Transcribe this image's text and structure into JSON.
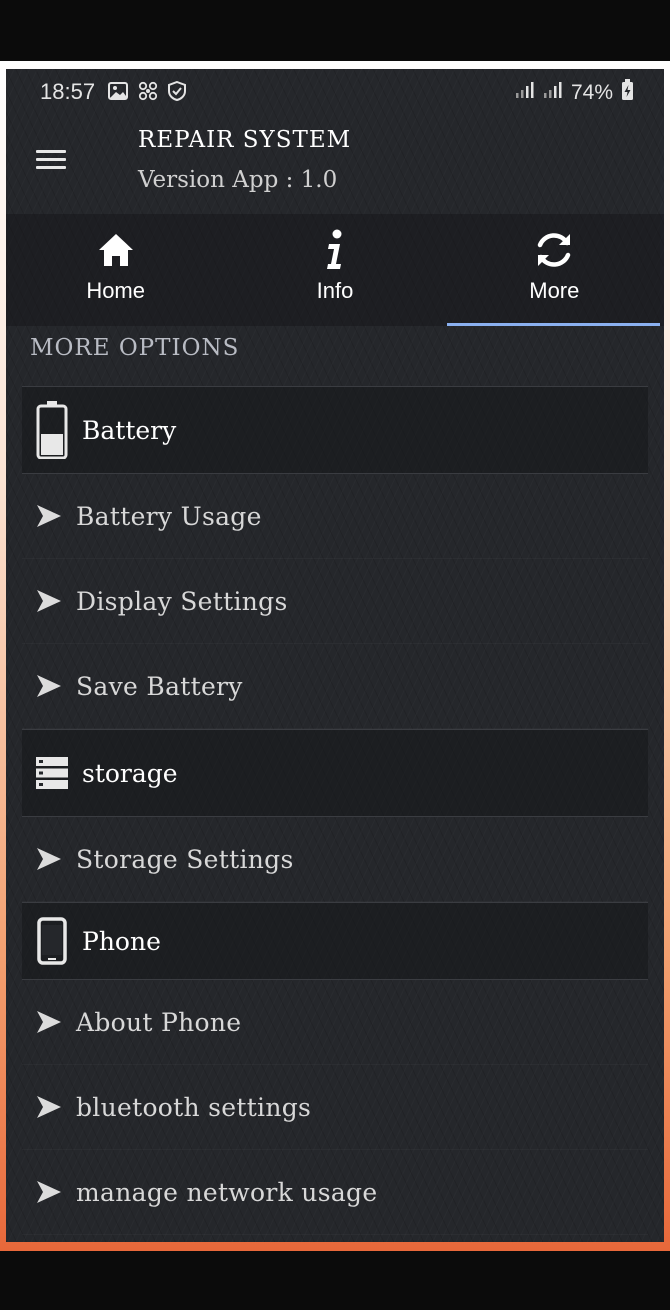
{
  "status_bar": {
    "time": "18:57",
    "battery_percent": "74%",
    "icons": [
      "image-icon",
      "fan-icon",
      "shield-icon",
      "signal-icon",
      "signal-icon",
      "battery-charging-icon"
    ]
  },
  "header": {
    "title": "REPAIR SYSTEM",
    "version": "Version App : 1.0"
  },
  "tabs": [
    {
      "label": "Home",
      "icon": "home-icon",
      "active": false
    },
    {
      "label": "Info",
      "icon": "info-icon",
      "active": false
    },
    {
      "label": "More",
      "icon": "refresh-icon",
      "active": true
    }
  ],
  "section_title": "MORE OPTIONS",
  "groups": [
    {
      "label": "Battery",
      "icon": "battery-icon",
      "items": [
        "Battery Usage",
        "Display Settings",
        "Save Battery"
      ]
    },
    {
      "label": "storage",
      "icon": "storage-icon",
      "items": [
        "Storage Settings"
      ]
    },
    {
      "label": "Phone",
      "icon": "phone-icon",
      "items": [
        "About Phone",
        "bluetooth settings",
        "manage network usage"
      ]
    }
  ],
  "colors": {
    "background": "#25272b",
    "tab_indicator": "#8ab0f0",
    "frame_accent": "#e8683a"
  }
}
